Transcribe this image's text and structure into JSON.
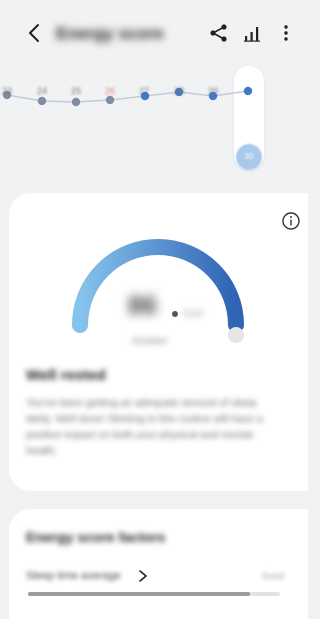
{
  "header": {
    "title": "Energy score"
  },
  "trend": {
    "days": [
      "23",
      "24",
      "25",
      "26",
      "27",
      "28",
      "29",
      "30"
    ],
    "today_label": "30",
    "highlight_day": "26",
    "highlight_color": "#e57c6f",
    "point_color_past": "#7f8da3",
    "point_color_recent": "#3f79c7"
  },
  "score_card": {
    "score": "86",
    "unit": "/100",
    "sublabel": "October",
    "status": "Well rested",
    "description": "You've been getting an adequate amount of sleep lately. Well done! Sticking to this routine will have a positive impact on both your physical and mental health."
  },
  "gauge": {
    "fraction": 1.0,
    "colors": [
      "#86c3ec",
      "#2f63b3"
    ]
  },
  "factors": {
    "title": "Energy score factors",
    "item_label": "Sleep time average",
    "item_value": "Good"
  },
  "scroll": {
    "fraction": 0.88
  },
  "icons": {
    "back": "back-arrow-icon",
    "share": "share-icon",
    "stats": "bar-chart-icon",
    "more": "more-icon",
    "info": "info-icon"
  }
}
